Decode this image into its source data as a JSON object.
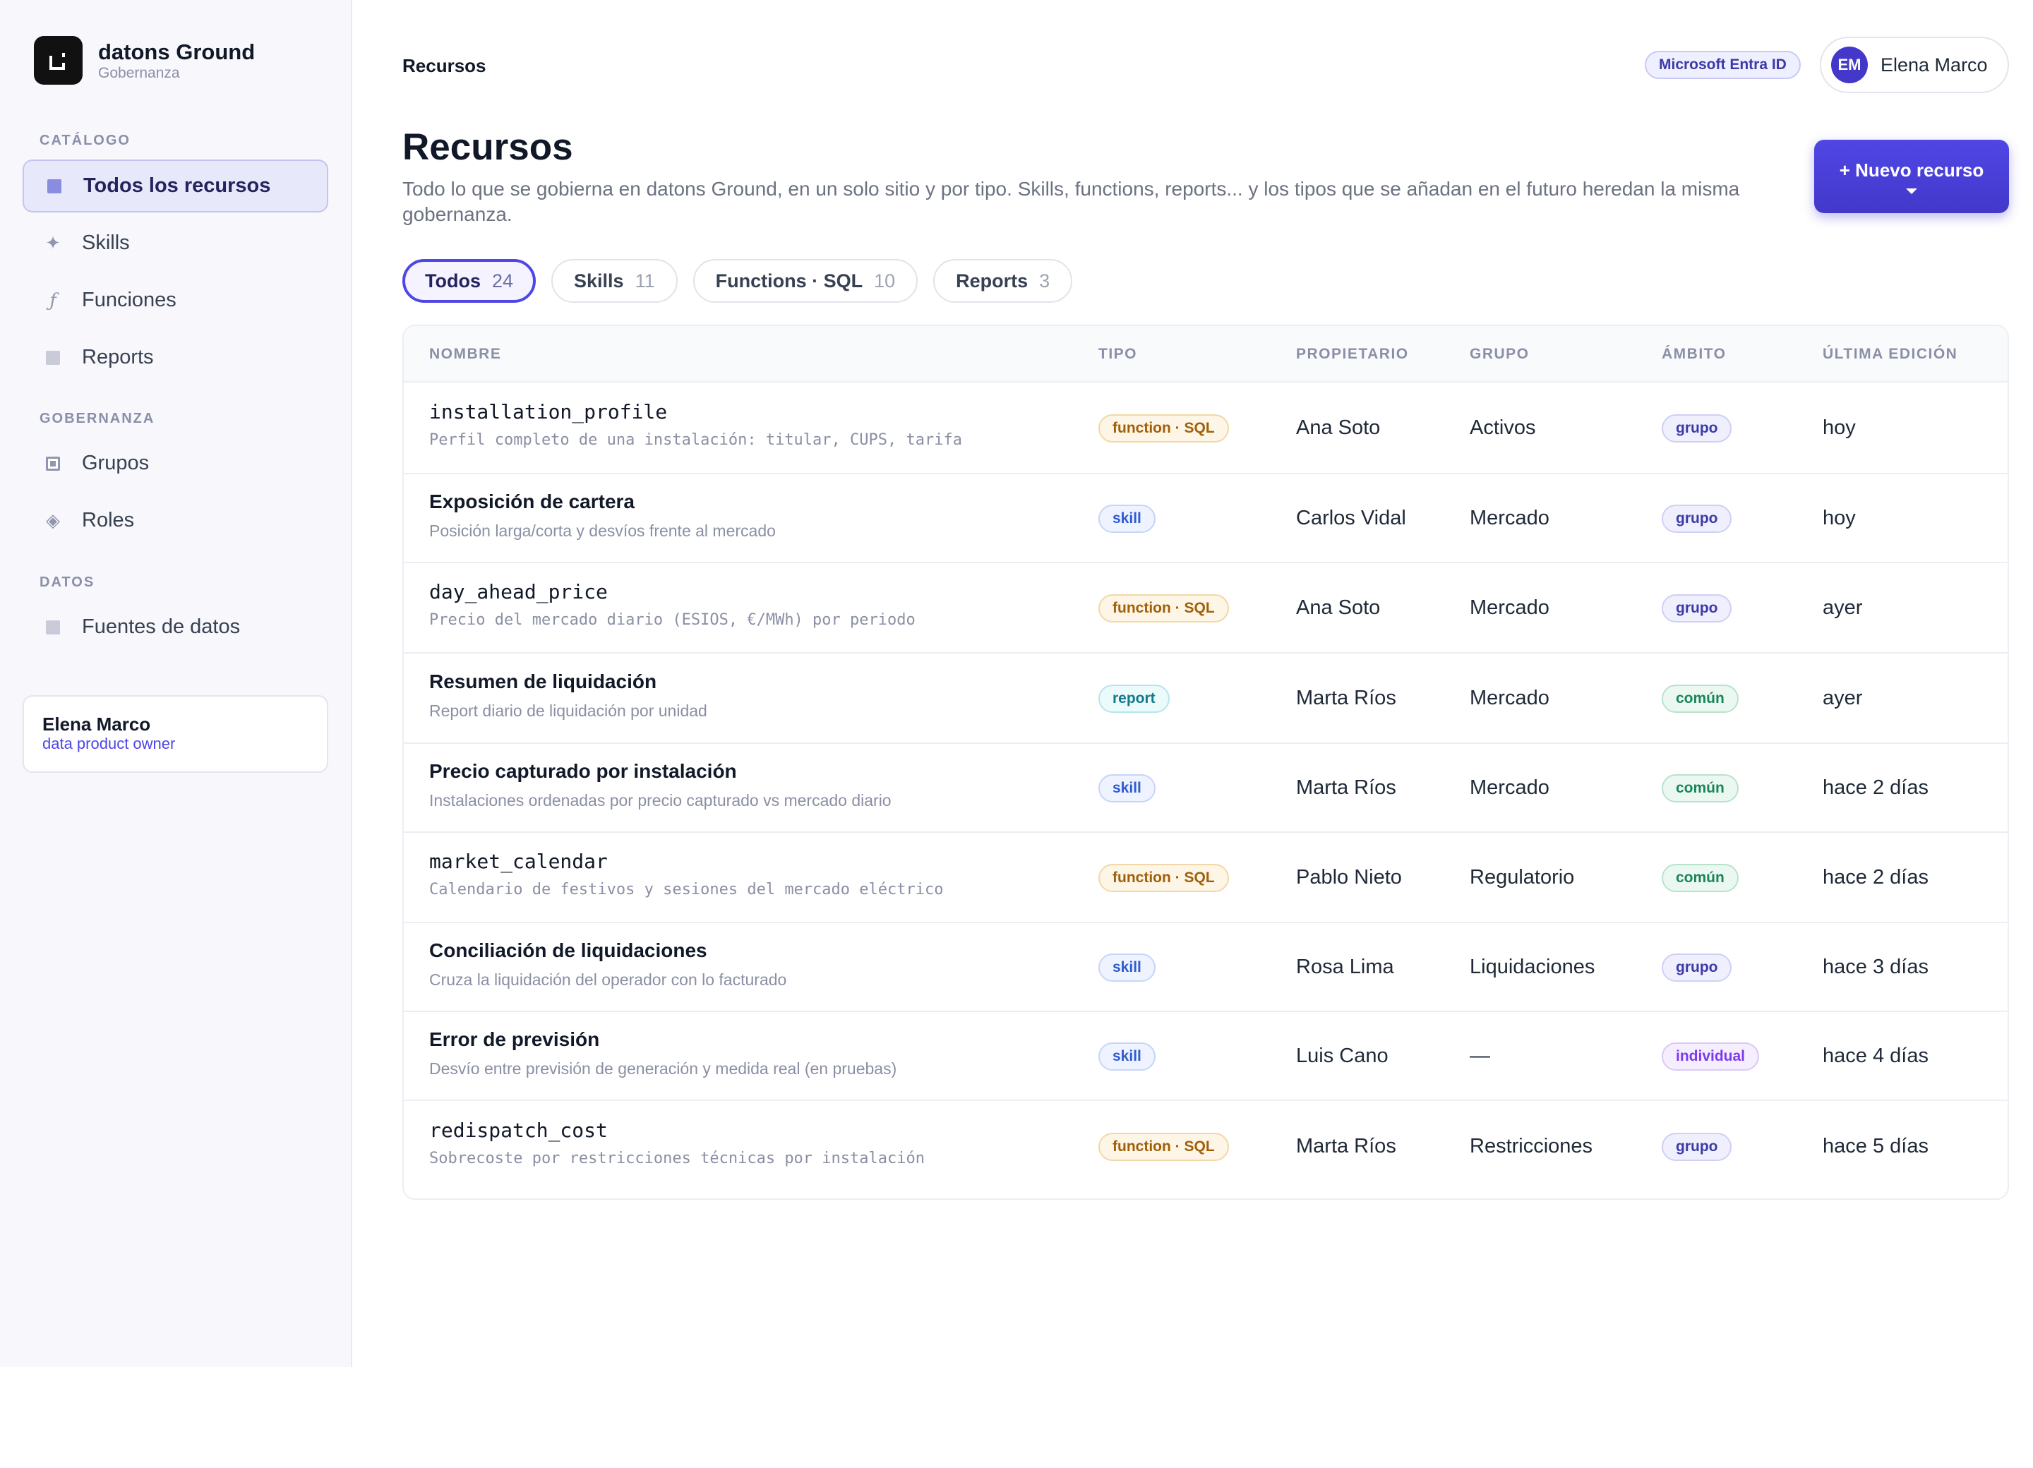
{
  "brand": {
    "name": "datons Ground",
    "subtitle": "Gobernanza",
    "logo_icon": "brand-logo-icon"
  },
  "sidebar": {
    "sections": [
      {
        "label": "CATÁLOGO"
      },
      {
        "label": "GOBERNANZA"
      },
      {
        "label": "DATOS"
      }
    ],
    "items": [
      {
        "label": "Todos los recursos",
        "icon": "square-icon",
        "active": true
      },
      {
        "label": "Skills",
        "icon": "sparkle-icon"
      },
      {
        "label": "Funciones",
        "icon": "function-icon"
      },
      {
        "label": "Reports",
        "icon": "square-icon"
      },
      {
        "label": "Grupos",
        "icon": "group-square-icon"
      },
      {
        "label": "Roles",
        "icon": "diamond-icon"
      },
      {
        "label": "Fuentes de datos",
        "icon": "square-icon"
      }
    ],
    "user": {
      "name": "Elena Marco",
      "role": "data product owner"
    }
  },
  "header": {
    "breadcrumb": "Recursos",
    "sso_badge": "Microsoft Entra ID",
    "user": {
      "initials": "EM",
      "name": "Elena Marco"
    }
  },
  "main": {
    "title": "Recursos",
    "description": "Todo lo que se gobierna en datons Ground, en un solo sitio y por tipo. Skills, functions, reports... y los tipos que se añadan en el futuro heredan la misma gobernanza.",
    "new_button": "+ Nuevo recurso",
    "filters": [
      {
        "label": "Todos",
        "count": "24",
        "active": true
      },
      {
        "label": "Skills",
        "count": "11"
      },
      {
        "label": "Functions · SQL",
        "count": "10"
      },
      {
        "label": "Reports",
        "count": "3"
      }
    ],
    "table": {
      "columns": [
        "NOMBRE",
        "TIPO",
        "PROPIETARIO",
        "GRUPO",
        "ÁMBITO",
        "ÚLTIMA EDICIÓN"
      ],
      "rows": [
        {
          "name": "installation_profile",
          "desc": "Perfil completo de una instalación: titular, CUPS, tarifa",
          "mono": true,
          "type": "function · SQL",
          "type_kind": "func",
          "owner": "Ana Soto",
          "group": "Activos",
          "scope": "grupo",
          "scope_kind": "grupo",
          "edited": "hoy"
        },
        {
          "name": "Exposición de cartera",
          "desc": "Posición larga/corta y desvíos frente al mercado",
          "mono": false,
          "type": "skill",
          "type_kind": "skill",
          "owner": "Carlos Vidal",
          "group": "Mercado",
          "scope": "grupo",
          "scope_kind": "grupo",
          "edited": "hoy"
        },
        {
          "name": "day_ahead_price",
          "desc": "Precio del mercado diario (ESIOS, €/MWh) por periodo",
          "mono": true,
          "type": "function · SQL",
          "type_kind": "func",
          "owner": "Ana Soto",
          "group": "Mercado",
          "scope": "grupo",
          "scope_kind": "grupo",
          "edited": "ayer"
        },
        {
          "name": "Resumen de liquidación",
          "desc": "Report diario de liquidación por unidad",
          "mono": false,
          "type": "report",
          "type_kind": "report",
          "owner": "Marta Ríos",
          "group": "Mercado",
          "scope": "común",
          "scope_kind": "comun",
          "edited": "ayer"
        },
        {
          "name": "Precio capturado por instalación",
          "desc": "Instalaciones ordenadas por precio capturado vs mercado diario",
          "mono": false,
          "type": "skill",
          "type_kind": "skill",
          "owner": "Marta Ríos",
          "group": "Mercado",
          "scope": "común",
          "scope_kind": "comun",
          "edited": "hace 2 días"
        },
        {
          "name": "market_calendar",
          "desc": "Calendario de festivos y sesiones del mercado eléctrico",
          "mono": true,
          "type": "function · SQL",
          "type_kind": "func",
          "owner": "Pablo Nieto",
          "group": "Regulatorio",
          "scope": "común",
          "scope_kind": "comun",
          "edited": "hace 2 días"
        },
        {
          "name": "Conciliación de liquidaciones",
          "desc": "Cruza la liquidación del operador con lo facturado",
          "mono": false,
          "type": "skill",
          "type_kind": "skill",
          "owner": "Rosa Lima",
          "group": "Liquidaciones",
          "scope": "grupo",
          "scope_kind": "grupo",
          "edited": "hace 3 días"
        },
        {
          "name": "Error de previsión",
          "desc": "Desvío entre previsión de generación y medida real (en pruebas)",
          "mono": false,
          "type": "skill",
          "type_kind": "skill",
          "owner": "Luis Cano",
          "group": "—",
          "scope": "individual",
          "scope_kind": "indiv",
          "edited": "hace 4 días"
        },
        {
          "name": "redispatch_cost",
          "desc": "Sobrecoste por restricciones técnicas por instalación",
          "mono": true,
          "type": "function · SQL",
          "type_kind": "func",
          "owner": "Marta Ríos",
          "group": "Restricciones",
          "scope": "grupo",
          "scope_kind": "grupo",
          "edited": "hace 5 días"
        }
      ]
    }
  },
  "colors": {
    "accent": "#4f46e5",
    "sidebar_bg": "#f7f7fc"
  }
}
